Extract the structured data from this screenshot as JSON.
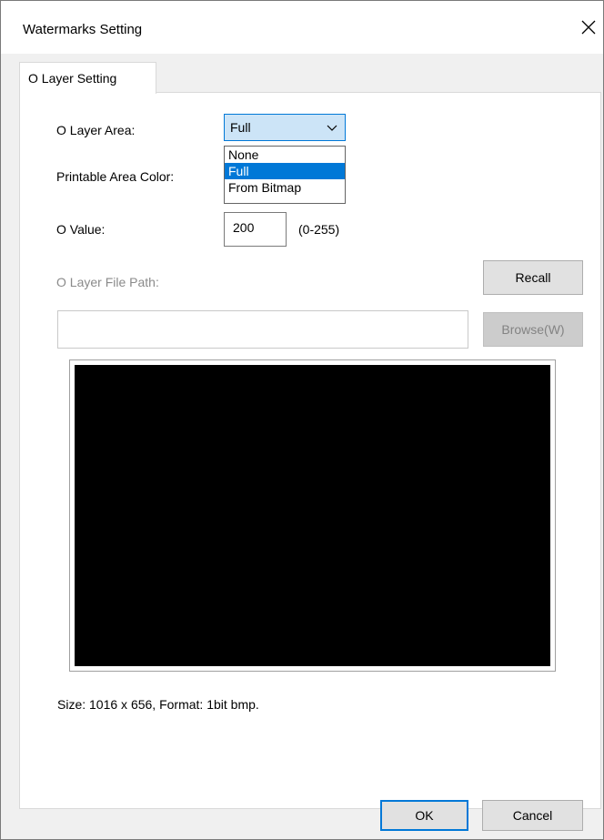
{
  "window": {
    "title": "Watermarks Setting"
  },
  "tabs": [
    {
      "label": "O Layer Setting"
    }
  ],
  "form": {
    "o_layer_area_label": "O Layer Area:",
    "o_layer_area_selected": "Full",
    "o_layer_area_options": [
      "None",
      "Full",
      "From Bitmap"
    ],
    "printable_area_color_label": "Printable Area Color:",
    "o_value_label": "O Value:",
    "o_value": "200",
    "o_value_range": "(0-255)",
    "file_path_label": "O Layer File Path:",
    "file_path_value": "",
    "recall_label": "Recall",
    "browse_label": "Browse(W)",
    "size_info": "Size: 1016 x 656, Format: 1bit bmp."
  },
  "footer": {
    "ok_label": "OK",
    "cancel_label": "Cancel"
  },
  "icons": {
    "close": "close-icon",
    "dropdown": "chevron-down-icon"
  },
  "colors": {
    "accent": "#0078d7",
    "selection": "#0078d7",
    "preview_fill": "#000000"
  }
}
